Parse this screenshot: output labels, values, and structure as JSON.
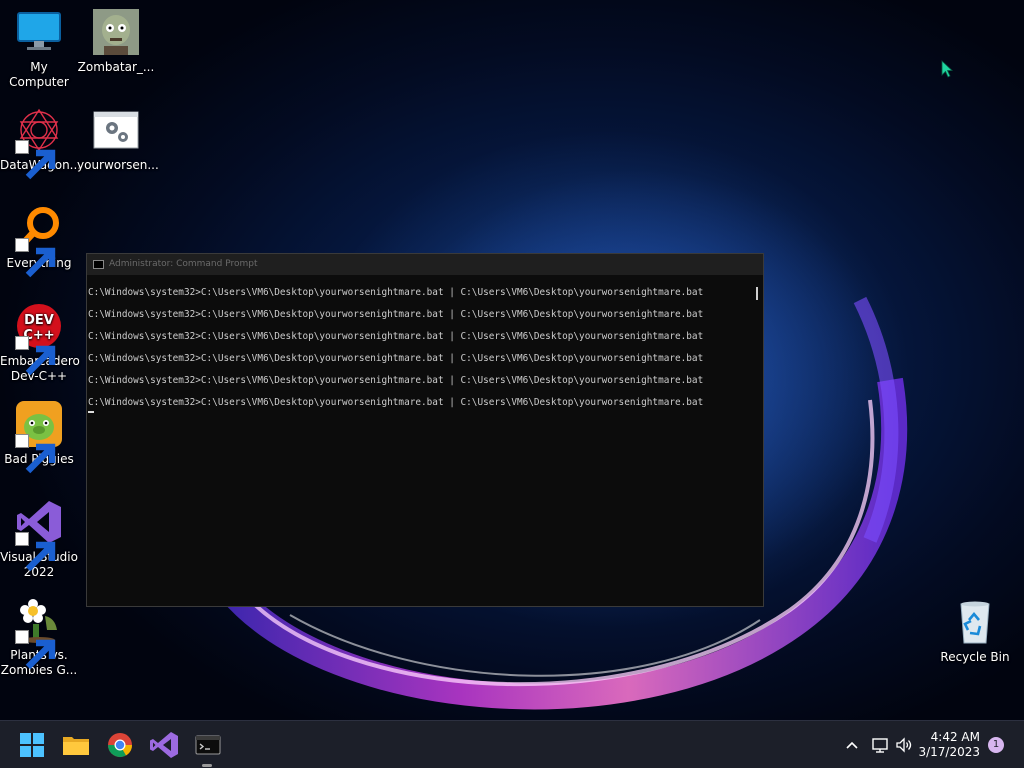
{
  "desktop": {
    "icons": [
      {
        "label": "My Computer"
      },
      {
        "label": "Zombatar_..."
      },
      {
        "label": "DataWagon..."
      },
      {
        "label": "yourworsen..."
      },
      {
        "label": "Everything"
      },
      {
        "label": "Embarcadero Dev-C++"
      },
      {
        "label": "Bad Piggies"
      },
      {
        "label": "Visual Studio 2022"
      },
      {
        "label": "Plants vs. Zombies G..."
      },
      {
        "label": "Recycle Bin"
      }
    ]
  },
  "console": {
    "title": "Administrator: Command Prompt",
    "lines": [
      "C:\\Windows\\system32>C:\\Users\\VM6\\Desktop\\yourworsenightmare.bat | C:\\Users\\VM6\\Desktop\\yourworsenightmare.bat",
      "C:\\Windows\\system32>C:\\Users\\VM6\\Desktop\\yourworsenightmare.bat | C:\\Users\\VM6\\Desktop\\yourworsenightmare.bat",
      "C:\\Windows\\system32>C:\\Users\\VM6\\Desktop\\yourworsenightmare.bat | C:\\Users\\VM6\\Desktop\\yourworsenightmare.bat",
      "C:\\Windows\\system32>C:\\Users\\VM6\\Desktop\\yourworsenightmare.bat | C:\\Users\\VM6\\Desktop\\yourworsenightmare.bat",
      "C:\\Windows\\system32>C:\\Users\\VM6\\Desktop\\yourworsenightmare.bat | C:\\Users\\VM6\\Desktop\\yourworsenightmare.bat",
      "C:\\Windows\\system32>C:\\Users\\VM6\\Desktop\\yourworsenightmare.bat | C:\\Users\\VM6\\Desktop\\yourworsenightmare.bat"
    ]
  },
  "taskbar": {
    "apps": [
      "windows-start-icon",
      "file-explorer-icon",
      "chrome-icon",
      "visual-studio-icon",
      "terminal-icon"
    ],
    "time": "4:42 AM",
    "date": "3/17/2023",
    "notification_count": "1"
  },
  "colors": {
    "accent": "#d7b6ef",
    "taskbar": "#1c1f29",
    "console_bg": "#0c0c0c"
  }
}
